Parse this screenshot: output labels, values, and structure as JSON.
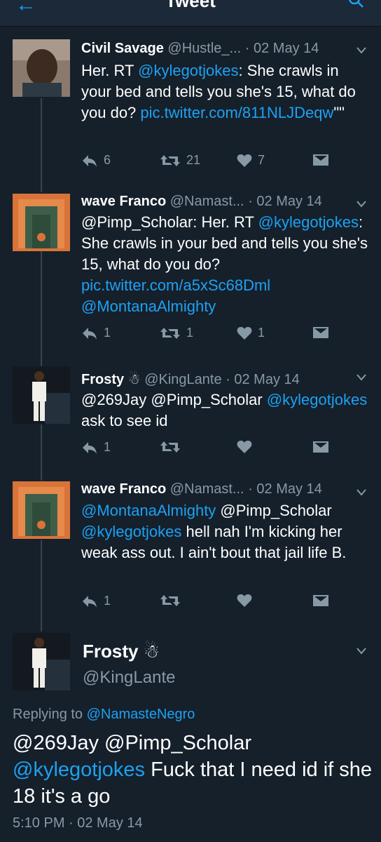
{
  "header": {
    "title": "Tweet"
  },
  "tweets": [
    {
      "name": "Civil Savage",
      "handle": "@Hustle_...",
      "date": "· 02 May 14",
      "parts": [
        {
          "t": "Her. RT "
        },
        {
          "t": "@kylegotjokes",
          "link": true
        },
        {
          "t": ": She crawls in your bed and tells you she's 15, what do you do? "
        },
        {
          "t": "pic.twitter.com/811NLJDeqw",
          "link": true
        },
        {
          "t": "\"\""
        }
      ],
      "replies": "6",
      "retweets": "21",
      "likes": "7"
    },
    {
      "name": "wave Franco",
      "handle": "@Namast...",
      "date": "· 02 May 14",
      "parts": [
        {
          "t": "@Pimp_Scholar: Her. RT "
        },
        {
          "t": "@kylegotjokes",
          "link": true
        },
        {
          "t": ": She crawls in your bed and tells you she's 15, what do you do? "
        },
        {
          "t": "pic.twitter.com/a5xSc68Dml",
          "link": true
        },
        {
          "t": " "
        },
        {
          "t": "@MontanaAlmighty",
          "link": true
        }
      ],
      "replies": "1",
      "retweets": "1",
      "likes": "1"
    },
    {
      "name": "Frosty",
      "handle": "@KingLante",
      "date": "· 02 May 14",
      "parts": [
        {
          "t": "@269Jay @Pimp_Scholar "
        },
        {
          "t": "@kylegotjokes",
          "link": true
        },
        {
          "t": " ask to see id"
        }
      ],
      "replies": "1",
      "retweets": "",
      "likes": ""
    },
    {
      "name": "wave Franco",
      "handle": "@Namast...",
      "date": "· 02 May 14",
      "parts": [
        {
          "t": "@MontanaAlmighty",
          "link": true
        },
        {
          "t": " @Pimp_Scholar "
        },
        {
          "t": "@kylegotjokes",
          "link": true
        },
        {
          "t": " hell nah I'm kicking her weak ass out. I ain't bout that jail life B."
        }
      ],
      "replies": "1",
      "retweets": "",
      "likes": ""
    }
  ],
  "main": {
    "name": "Frosty",
    "handle": "@KingLante",
    "replying_prefix": "Replying to ",
    "replying_to": "@NamasteNegro",
    "parts": [
      {
        "t": "@269Jay @Pimp_Scholar "
      },
      {
        "t": "@kylegotjokes",
        "link": true
      },
      {
        "t": " Fuck that I need id if she 18 it's a go"
      }
    ],
    "timestamp": "5:10 PM · 02 May 14"
  },
  "colors": {
    "background": "#15202b",
    "link": "#1da1f2",
    "muted": "#8899a6",
    "line": "#38444d"
  }
}
